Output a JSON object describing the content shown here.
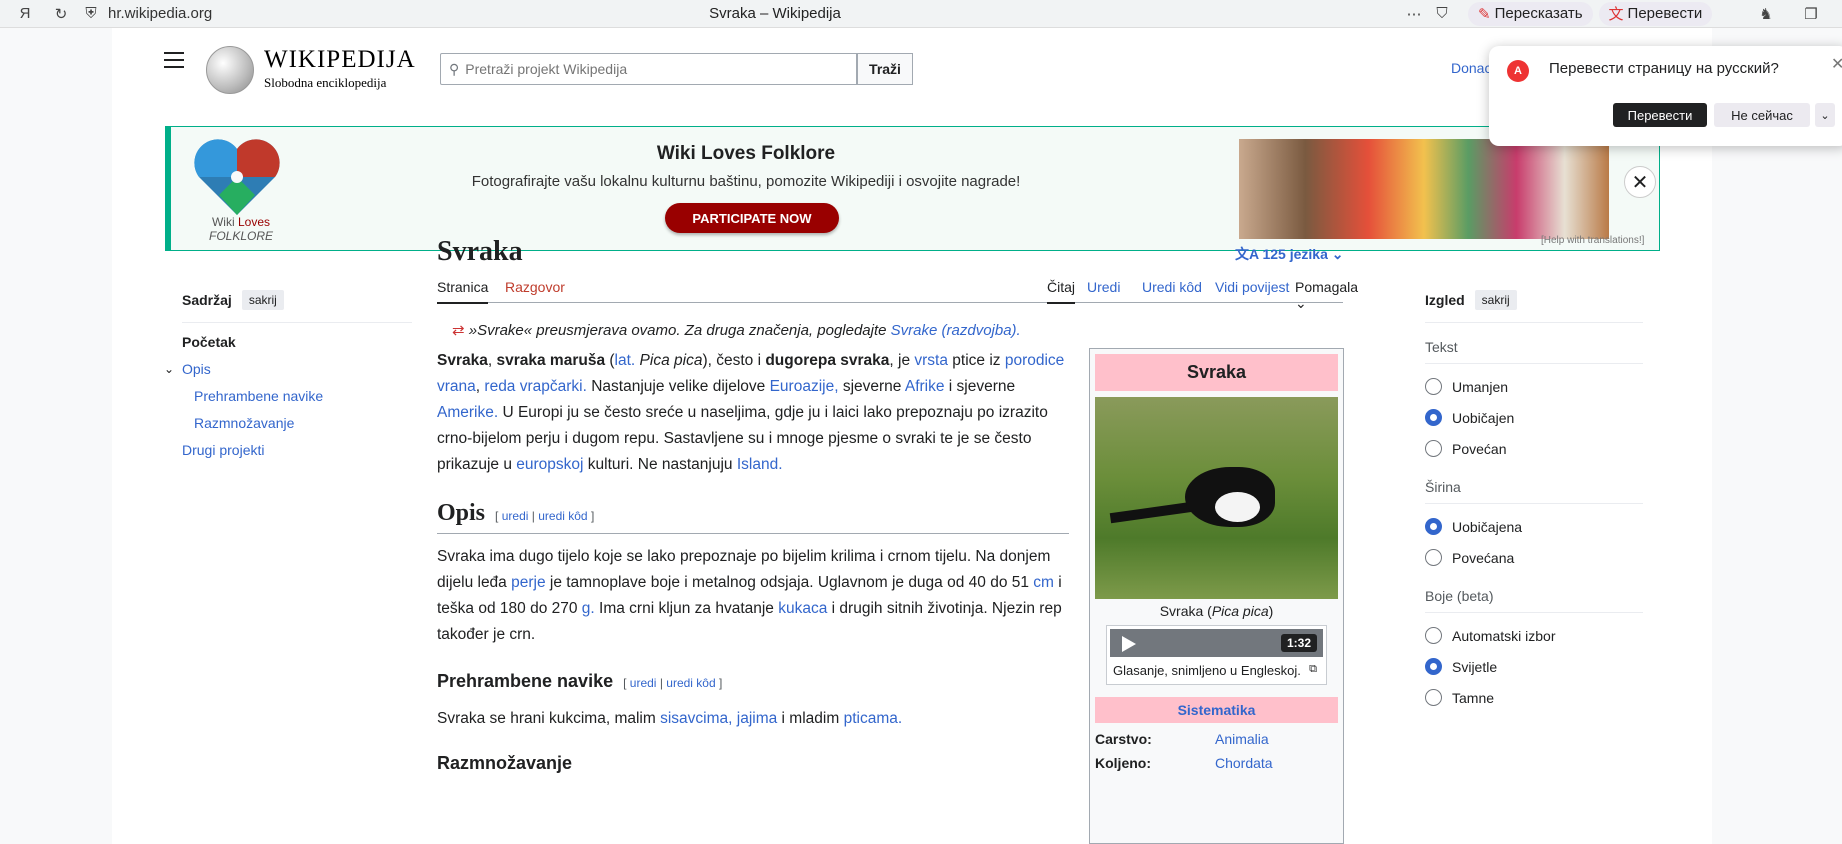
{
  "browser": {
    "url": "hr.wikipedia.org",
    "tab_title": "Svraka – Wikipedija",
    "retell_label": "Пересказать",
    "translate_label": "Перевести"
  },
  "header": {
    "wordmark": "WIKIPEDIJA",
    "tagline": "Slobodna enciklopedija",
    "search_placeholder": "Pretraži projekt Wikipedija",
    "search_button": "Traži",
    "donate": "Donac"
  },
  "banner": {
    "title": "Wiki Loves Folklore",
    "subtitle": "Fotografirajte vašu lokalnu kulturnu baštinu, pomozite Wikipediji i osvojite nagrade!",
    "button": "PARTICIPATE NOW",
    "logo_line1": "Wiki",
    "logo_line1b": "Loves",
    "logo_line2": "FOLKLORE",
    "help": "[Help with translations!]"
  },
  "popup": {
    "title": "Перевести страницу на русский?",
    "primary": "Перевести",
    "secondary": "Не сейчас"
  },
  "article": {
    "title": "Svraka",
    "languages": "125 jezika",
    "tabs_left": [
      "Stranica",
      "Razgovor"
    ],
    "tabs_right": [
      "Čitaj",
      "Uredi",
      "Uredi kôd",
      "Vidi povijest",
      "Pomagala"
    ],
    "hatnote_text": "»Svrake« preusmjerava ovamo. Za druga značenja, pogledajte ",
    "hatnote_link": "Svrake (razdvojba).",
    "intro": {
      "b1": "Svraka",
      "t1": ", ",
      "b2": "svraka maruša",
      "t2": " (",
      "l1": "lat.",
      "i1": " Pica pica",
      "t3": "), često i ",
      "b3": "dugorepa svraka",
      "t4": ", je ",
      "l2": "vrsta",
      "t5": " ptice iz ",
      "l3": "porodice vrana",
      "t6": ", ",
      "l4": "reda vrapčarki.",
      "t7": " Nastanjuje velike dijelove ",
      "l5": "Euroazije,",
      "t8": " sjeverne ",
      "l6": "Afrike",
      "t9": " i sjeverne ",
      "l7": "Amerike.",
      "t10": " U Europi ju se često sreće u naseljima, gdje ju i laici lako prepoznaju po izrazito crno-bijelom perju i dugom repu. Sastavljene su i mnoge pjesme o svraki te je se često prikazuje u ",
      "l8": "europskoj",
      "t11": " kulturi. Ne nastanjuju ",
      "l9": "Island."
    },
    "h_opis": "Opis",
    "edit_sec_open": "[",
    "edit_sec_a": "uredi",
    "edit_sec_sep": "|",
    "edit_sec_b": "uredi kôd",
    "edit_sec_close": "]",
    "opis": {
      "t1": "Svraka ima dugo tijelo koje se lako prepoznaje po bijelim krilima i crnom tijelu. Na donjem dijelu leđa ",
      "l1": "perje",
      "t2": " je tamnoplave boje i metalnog odsjaja. Uglavnom je duga od 40 do 51 ",
      "l2": "cm",
      "t3": " i teška od 180 do 270 ",
      "l3": "g.",
      "t4": " Ima crni kljun za hvatanje ",
      "l4": "kukaca",
      "t5": " i drugih sitnih životinja. Njezin rep također je crn."
    },
    "h_prehrana": "Prehrambene navike",
    "prehrana": {
      "t1": "Svraka se hrani kukcima, malim ",
      "l1": "sisavcima,",
      "l2": "jajima",
      "t2": " i mladim ",
      "l3": "pticama."
    },
    "h_razm": "Razmnožavanje"
  },
  "toc": {
    "title": "Sadržaj",
    "hide": "sakrij",
    "items": [
      "Početak",
      "Opis",
      "Prehrambene navike",
      "Razmnožavanje",
      "Drugi projekti"
    ]
  },
  "infobox": {
    "title": "Svraka",
    "caption_a": "Svraka (",
    "caption_i": "Pica pica",
    "caption_b": ")",
    "audio_duration": "1:32",
    "audio_caption": "Glasanje, snimljeno u Engleskoj.",
    "systematics": "Sistematika",
    "rows": [
      {
        "k": "Carstvo:",
        "v": "Animalia"
      },
      {
        "k": "Koljeno:",
        "v": "Chordata"
      }
    ]
  },
  "appearance": {
    "title": "Izgled",
    "hide": "sakrij",
    "text_label": "Tekst",
    "text_opts": [
      "Umanjen",
      "Uobičajen",
      "Povećan"
    ],
    "width_label": "Širina",
    "width_opts": [
      "Uobičajena",
      "Povećana"
    ],
    "color_label": "Boje (beta)",
    "color_opts": [
      "Automatski izbor",
      "Svijetle",
      "Tamne"
    ]
  }
}
